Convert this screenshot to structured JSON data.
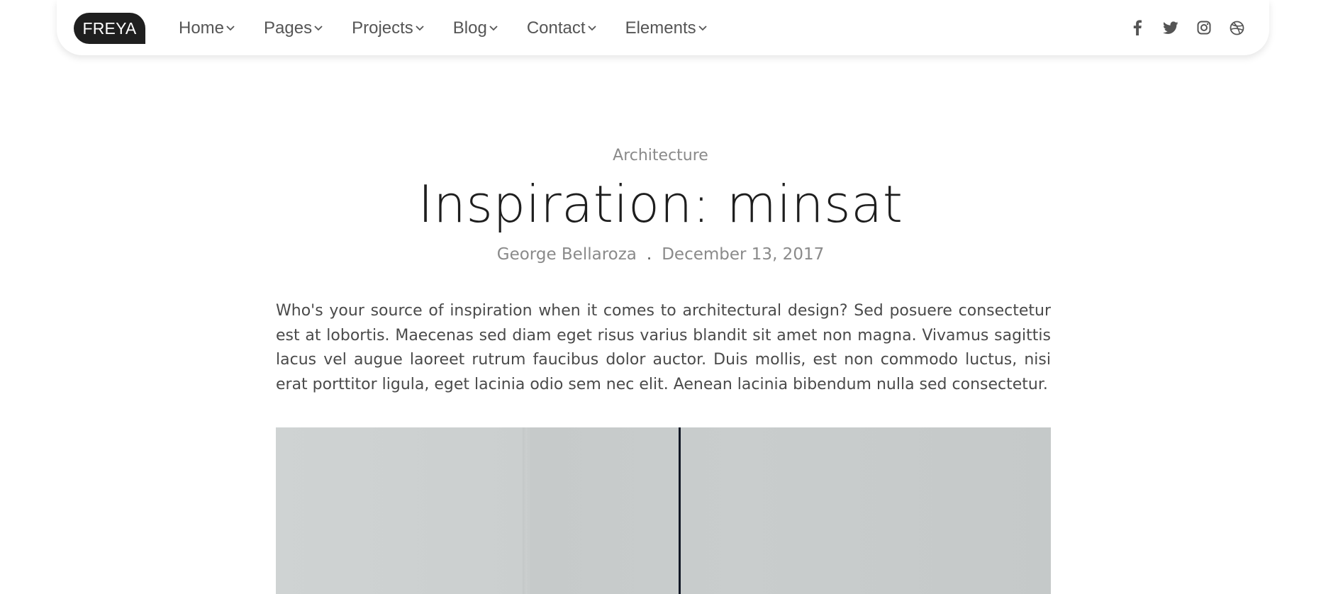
{
  "nav": {
    "logo": "FREYA",
    "items": [
      {
        "label": "Home"
      },
      {
        "label": "Pages"
      },
      {
        "label": "Projects"
      },
      {
        "label": "Blog"
      },
      {
        "label": "Contact"
      },
      {
        "label": "Elements"
      }
    ],
    "social_icons": [
      "facebook-icon",
      "twitter-icon",
      "instagram-icon",
      "dribbble-icon"
    ]
  },
  "post": {
    "category": "Architecture",
    "title": "Inspiration: minsat",
    "author": "George Bellaroza",
    "separator": ".",
    "date": "December 13, 2017",
    "body": "Who's your source of inspiration when it comes to architectural design? Sed posuere consectetur est at lobortis. Maecenas sed diam eget risus varius blandit sit amet non magna. Vivamus sagittis lacus vel augue laoreet rutrum faucibus dolor auctor. Duis mollis, est non commodo luctus, nisi erat porttitor ligula, eget lacinia odio sem nec elit. Aenean lacinia bibendum nulla sed consectetur."
  },
  "colors": {
    "logo_bg": "#1f1f1f",
    "nav_text": "#555555",
    "muted_text": "#8a8a8a",
    "title_text": "#1e1e1e",
    "body_text": "#4a4a4a"
  }
}
